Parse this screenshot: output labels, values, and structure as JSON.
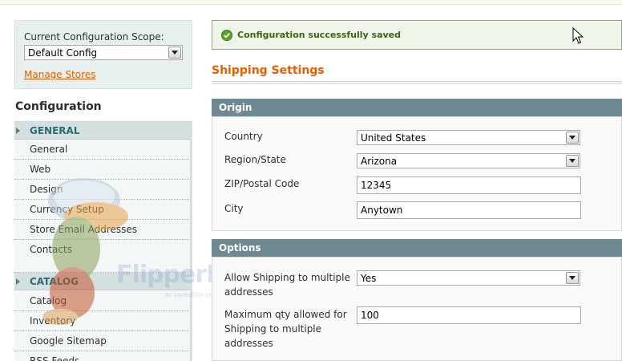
{
  "sidebar": {
    "scope_label": "Current Configuration Scope:",
    "scope_value": "Default Config",
    "manage_stores": "Manage Stores",
    "config_title": "Configuration",
    "sections": [
      {
        "label": "GENERAL",
        "items": [
          "General",
          "Web",
          "Design",
          "Currency Setup",
          "Store Email Addresses",
          "Contacts"
        ]
      },
      {
        "label": "CATALOG",
        "items": [
          "Catalog",
          "Inventory",
          "Google Sitemap",
          "RSS Feeds"
        ]
      }
    ]
  },
  "watermark": {
    "text": "FlipperHost",
    "sub": "an investion company"
  },
  "messages": {
    "success": "Configuration successfully saved"
  },
  "page": {
    "title": "Shipping Settings"
  },
  "origin": {
    "header": "Origin",
    "country_label": "Country",
    "country_value": "United States",
    "region_label": "Region/State",
    "region_value": "Arizona",
    "zip_label": "ZIP/Postal Code",
    "zip_value": "12345",
    "city_label": "City",
    "city_value": "Anytown"
  },
  "options": {
    "header": "Options",
    "multi_label_1": "Allow Shipping to multiple",
    "multi_label_2": "addresses",
    "multi_value": "Yes",
    "maxqty_label_1": "Maximum qty allowed for",
    "maxqty_label_2": "Shipping to multiple",
    "maxqty_label_3": "addresses",
    "maxqty_value": "100"
  },
  "colors": {
    "accent": "#eb5e00",
    "section_header": "#6f8992",
    "success_text": "#3d6611"
  },
  "icons": {
    "success": "check-circle-icon",
    "cursor": "mouse-pointer-icon",
    "expand": "triangle-right-icon"
  }
}
